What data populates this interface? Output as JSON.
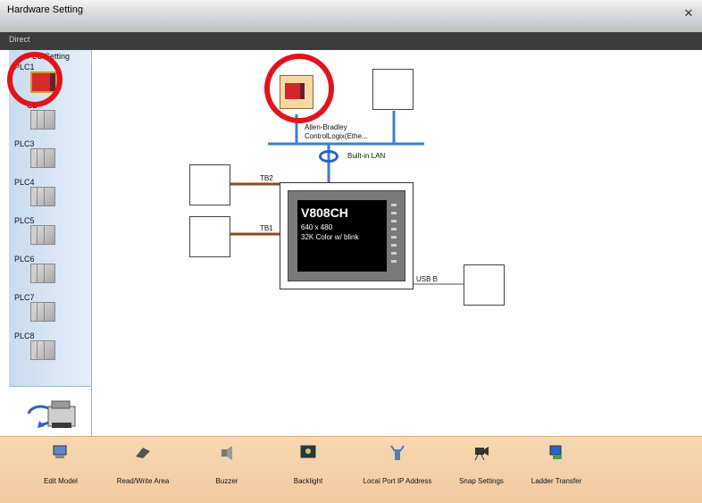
{
  "window": {
    "title": "Hardware Setting"
  },
  "tabbar": {
    "tab_label": "Direct"
  },
  "sidebar": {
    "setting_label": "PLC Setting",
    "items": [
      {
        "label": "PLC1",
        "active": true
      },
      {
        "label": "C2"
      },
      {
        "label": "PLC3"
      },
      {
        "label": "PLC4"
      },
      {
        "label": "PLC5"
      },
      {
        "label": "PLC6"
      },
      {
        "label": "PLC7"
      },
      {
        "label": "PLC8"
      }
    ]
  },
  "diagram": {
    "plc_name_line1": "Allen-Bradley",
    "plc_name_line2": "ControlLogix(Ethe...",
    "lan_label": "Built-in LAN",
    "tb2_label": "TB2",
    "tb1_label": "TB1",
    "usb_label": "USB B",
    "device_model": "V808CH",
    "device_res": "640 x 480",
    "device_color": "32K Color w/ blink"
  },
  "toolbar": {
    "items": [
      {
        "label": "Edit Model",
        "icon": "edit-model-icon"
      },
      {
        "label": "Read/Write Area",
        "icon": "read-write-area-icon"
      },
      {
        "label": "Buzzer",
        "icon": "buzzer-icon"
      },
      {
        "label": "Backlight",
        "icon": "backlight-icon"
      },
      {
        "label": "Local Port IP Address",
        "icon": "local-port-ip-icon"
      },
      {
        "label": "Snap Settings",
        "icon": "snap-settings-icon"
      },
      {
        "label": "Ladder Transfer",
        "icon": "ladder-transfer-icon"
      }
    ]
  },
  "colors": {
    "lan_blue": "#3a7fd5",
    "serial_brown": "#8b4a23",
    "highlight_red": "#e3131b",
    "toolbar_bg": "#f2caa0"
  }
}
